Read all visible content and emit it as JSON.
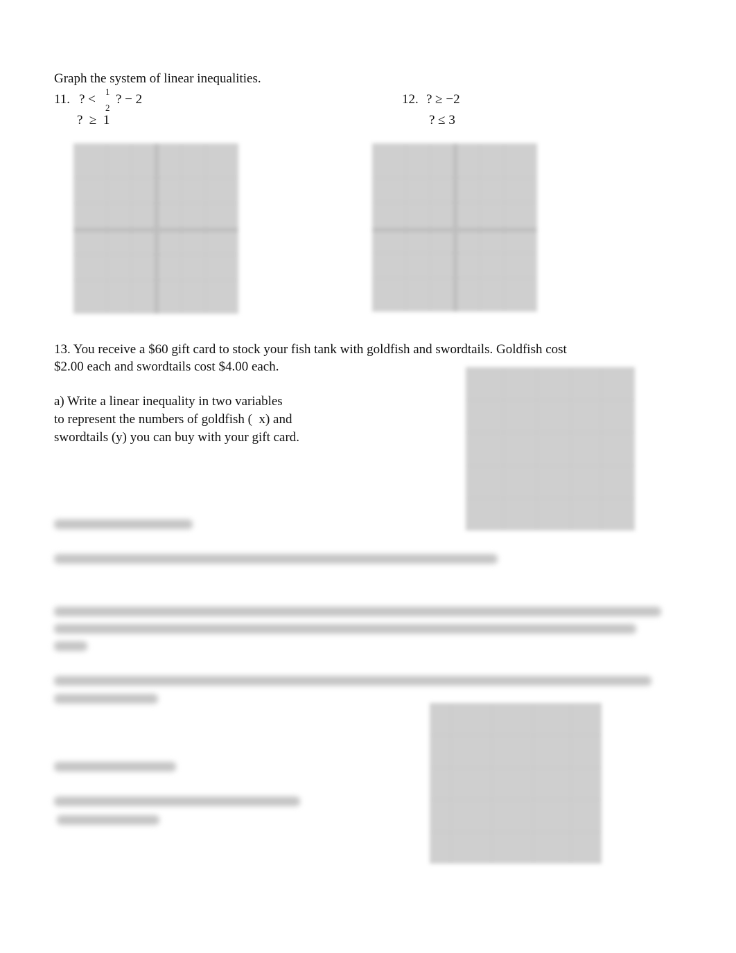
{
  "heading": "Graph the system of linear inequalities.",
  "problem_11": {
    "number": "11.",
    "line1_left": "? <",
    "fraction_numerator": "1",
    "fraction_denominator": "2",
    "line1_right": "? − 2",
    "line2": "?  ≥  1"
  },
  "problem_12": {
    "number": "12.",
    "line1": "? ≥ −2",
    "line2": "? ≤ 3"
  },
  "problem_13": {
    "line1": "13.  You receive a $60 gift card to stock your fish tank with goldfish and swordtails.    Goldfish cost",
    "line2": "$2.00 each and swordtails cost $4.00 each.",
    "part_a": [
      "a)  Write a linear inequality in two variables",
      "to represent the numbers of goldfish (  x) and",
      "swordtails (y) you can buy with your gift card."
    ]
  },
  "graphs": [
    {
      "name": "graph-problem-11",
      "type": "coordinate-grid-four-quadrant"
    },
    {
      "name": "graph-problem-12",
      "type": "coordinate-grid-four-quadrant"
    },
    {
      "name": "graph-problem-13",
      "type": "coordinate-grid-first-quadrant"
    },
    {
      "name": "graph-problem-14",
      "type": "coordinate-grid-first-quadrant"
    }
  ],
  "blurred_content_note": "remaining text obscured"
}
